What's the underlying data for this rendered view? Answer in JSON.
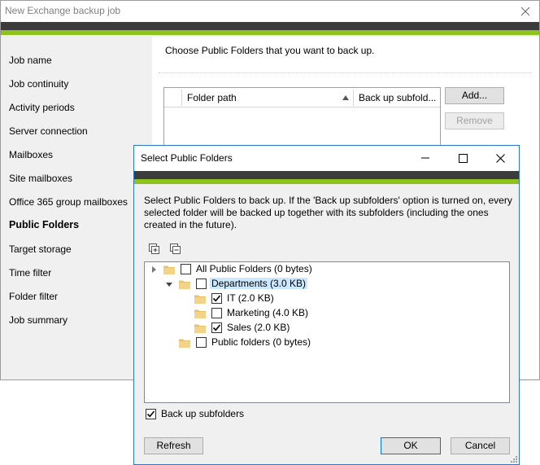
{
  "main_window": {
    "title": "New Exchange backup job",
    "nav": [
      {
        "label": "Job name",
        "active": false
      },
      {
        "label": "Job continuity",
        "active": false
      },
      {
        "label": "Activity periods",
        "active": false
      },
      {
        "label": "Server connection",
        "active": false
      },
      {
        "label": "Mailboxes",
        "active": false
      },
      {
        "label": "Site mailboxes",
        "active": false
      },
      {
        "label": "Office 365 group mailboxes",
        "active": false
      },
      {
        "label": "Public Folders",
        "active": true
      },
      {
        "label": "Target storage",
        "active": false
      },
      {
        "label": "Time filter",
        "active": false
      },
      {
        "label": "Folder filter",
        "active": false
      },
      {
        "label": "Job summary",
        "active": false
      }
    ],
    "content": {
      "instruction": "Choose Public Folders that you want to back up.",
      "table": {
        "columns": [
          "Folder path",
          "Back up subfold..."
        ]
      },
      "add_button": "Add...",
      "remove_button": "Remove"
    }
  },
  "dialog": {
    "title": "Select Public Folders",
    "instruction": "Select Public Folders to back up. If the 'Back up subfolders' option is turned on, every selected folder will be backed up together with its subfolders (including the ones created in the future).",
    "tree": [
      {
        "label": "All Public Folders (0 bytes)",
        "level": 0,
        "expander": "expanded-right",
        "checked": false,
        "selected": false
      },
      {
        "label": "Departments (3.0 KB)",
        "level": 1,
        "expander": "expanded-down",
        "checked": false,
        "selected": true
      },
      {
        "label": "IT (2.0 KB)",
        "level": 2,
        "expander": "none",
        "checked": true,
        "selected": false
      },
      {
        "label": "Marketing (4.0 KB)",
        "level": 2,
        "expander": "none",
        "checked": false,
        "selected": false
      },
      {
        "label": "Sales (2.0 KB)",
        "level": 2,
        "expander": "none",
        "checked": true,
        "selected": false
      },
      {
        "label": "Public folders (0 bytes)",
        "level": 1,
        "expander": "none",
        "checked": false,
        "selected": false
      }
    ],
    "backup_subfolders": {
      "label": "Back up subfolders",
      "checked": true
    },
    "refresh_button": "Refresh",
    "ok_button": "OK",
    "cancel_button": "Cancel"
  },
  "colors": {
    "brand_dark": "#3c3c3c",
    "brand_green": "#8dc21f",
    "dialog_border": "#2b79c7",
    "selection": "#cce8ff",
    "folder": "#e8c16b"
  }
}
